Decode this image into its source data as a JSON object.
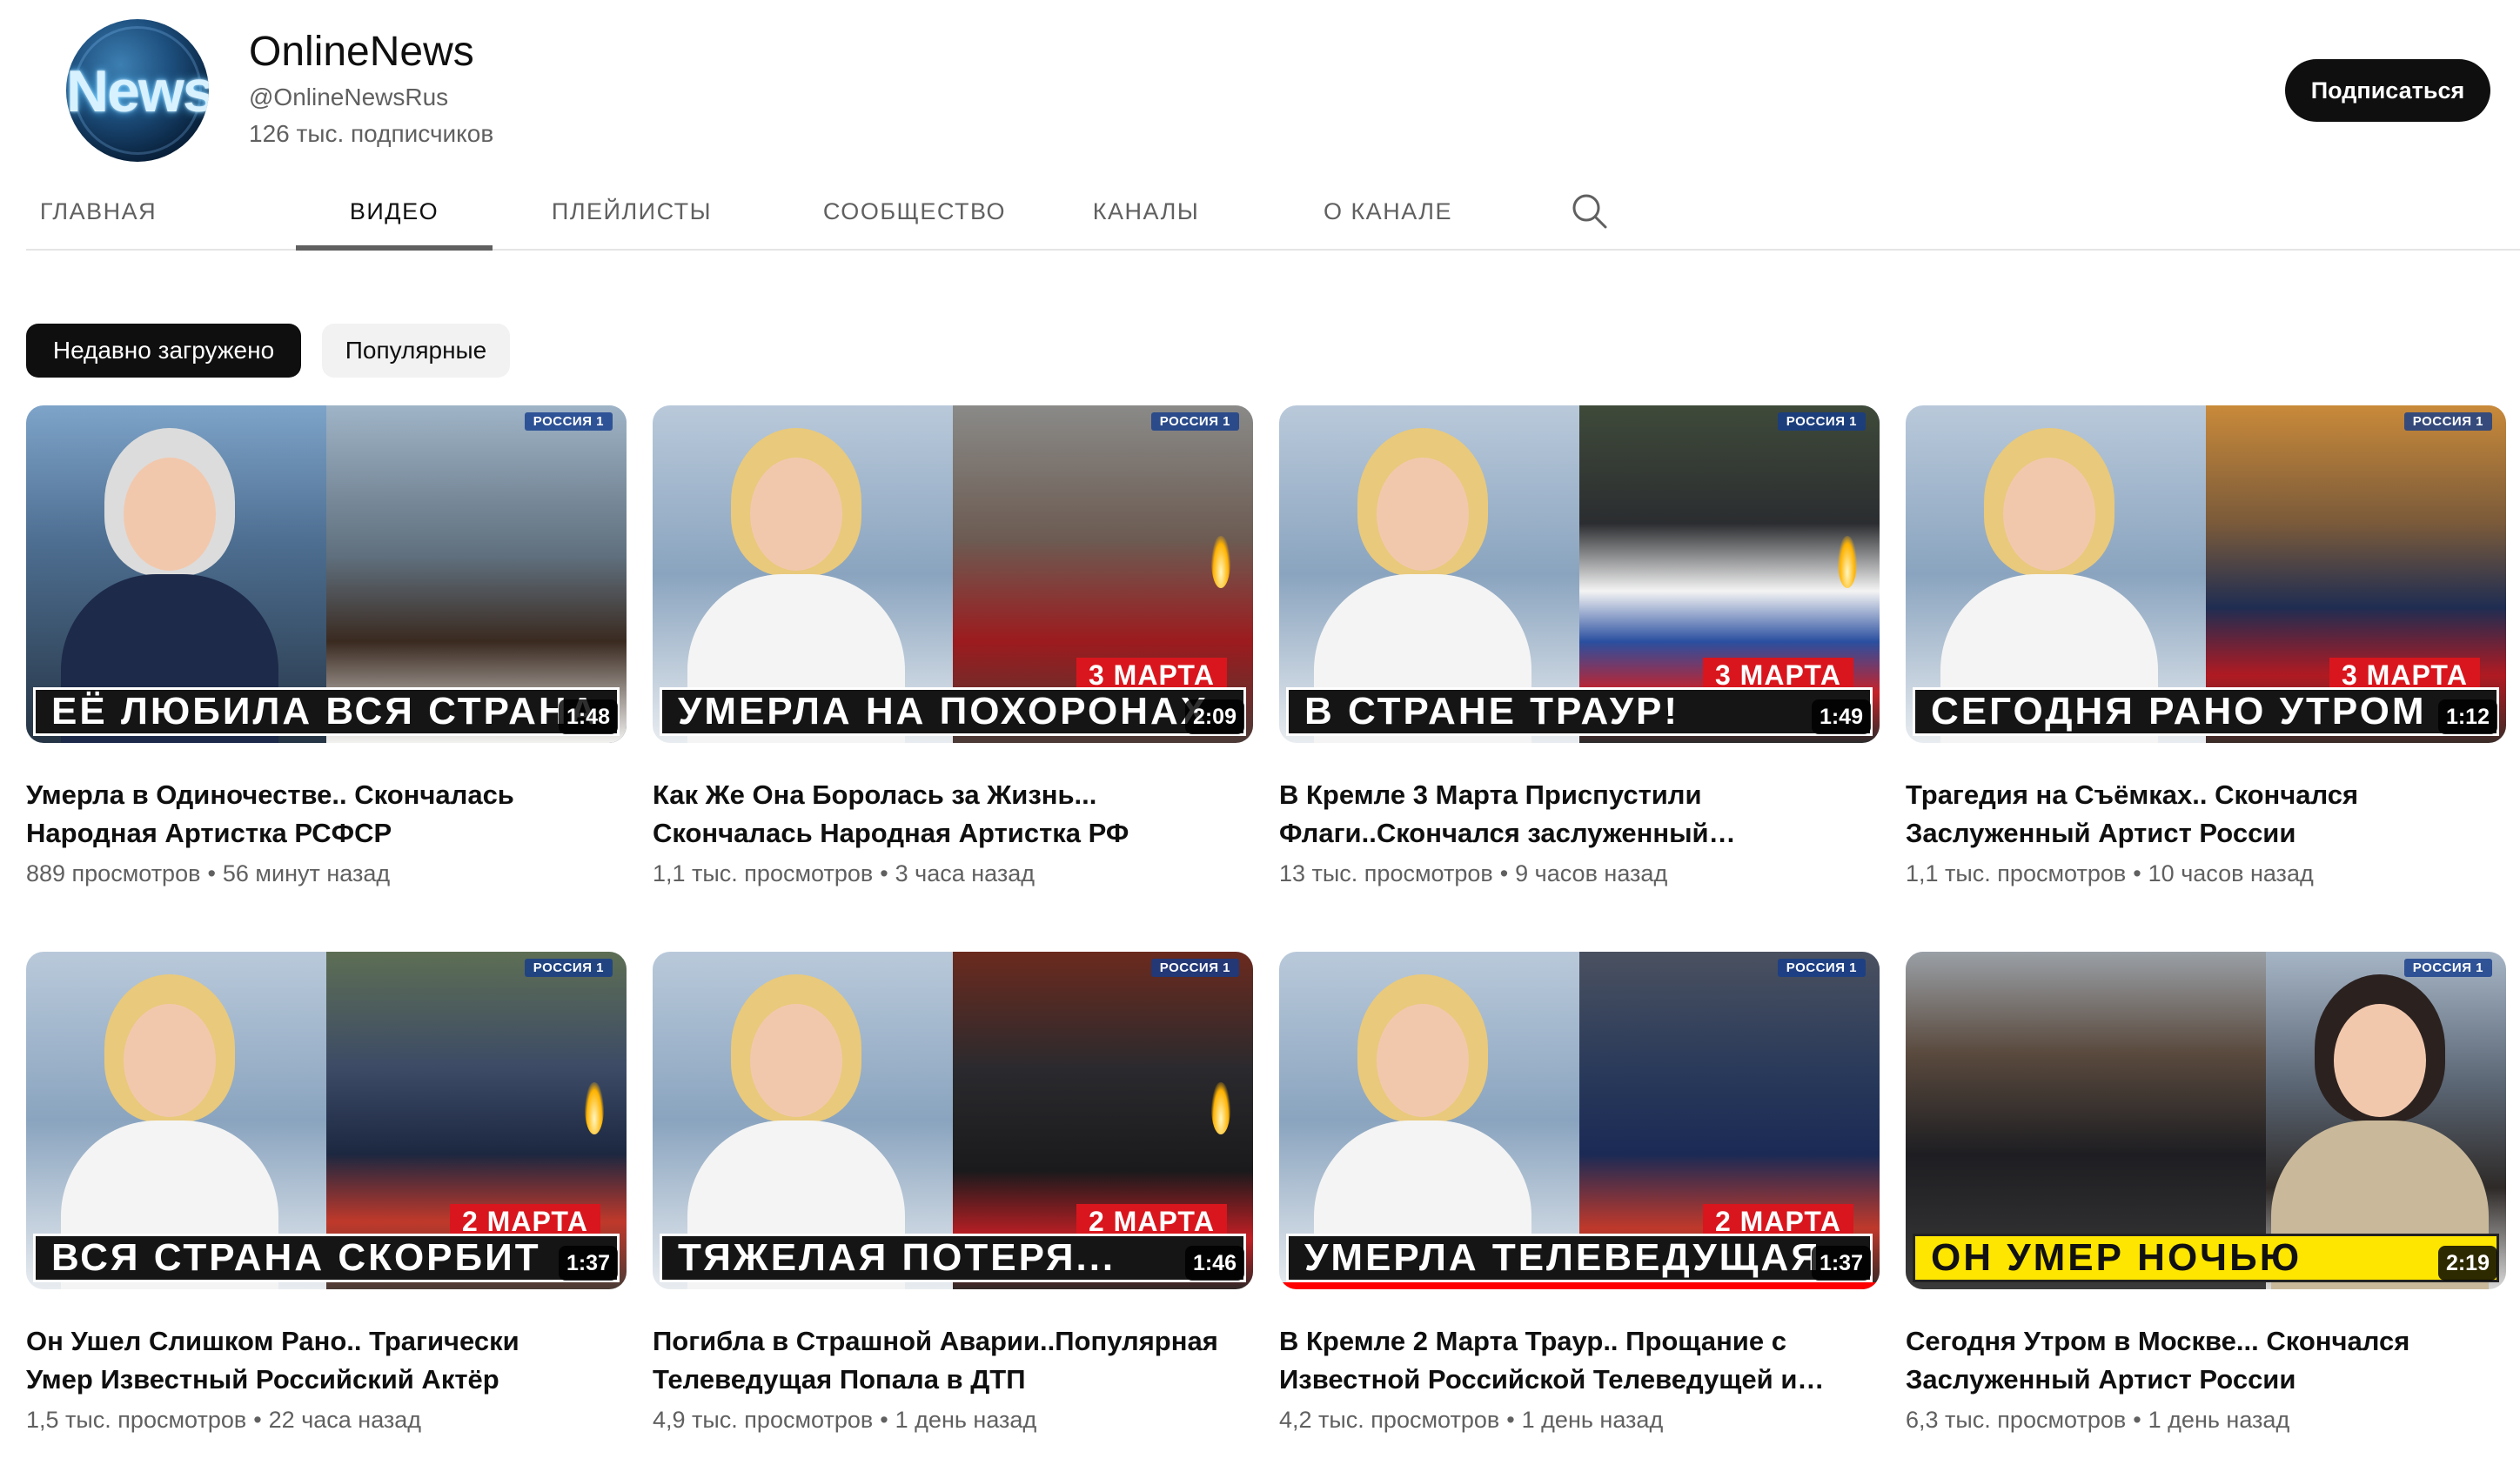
{
  "channel": {
    "avatar_text": "News",
    "name": "OnlineNews",
    "handle": "@OnlineNewsRus",
    "subscribers": "126 тыс. подписчиков",
    "subscribe_label": "Подписаться"
  },
  "tabs": [
    {
      "label": "ГЛАВНАЯ",
      "active": false
    },
    {
      "label": "ВИДЕО",
      "active": true
    },
    {
      "label": "ПЛЕЙЛИСТЫ",
      "active": false
    },
    {
      "label": "СООБЩЕСТВО",
      "active": false
    },
    {
      "label": "КАНАЛЫ",
      "active": false
    },
    {
      "label": "О КАНАЛЕ",
      "active": false
    }
  ],
  "search_icon": "search-icon",
  "chips": [
    {
      "label": "Недавно загружено",
      "selected": true
    },
    {
      "label": "Популярные",
      "selected": false
    }
  ],
  "videos": [
    {
      "caption": "ЕЁ ЛЮБИЛА ВСЯ СТРАНА",
      "date_tag": "",
      "channel_logo": "РОССИЯ 1",
      "duration": "1:48",
      "title_line1": "Умерла в Одиночестве.. Скончалась",
      "title_line2": "Народная Артистка РСФСР",
      "views": "889 просмотров",
      "age": "56 минут назад",
      "watched": false
    },
    {
      "caption": "УМЕРЛА НА ПОХОРОНАХ",
      "date_tag": "3 МАРТА",
      "channel_logo": "РОССИЯ 1",
      "duration": "2:09",
      "title_line1": "Как Же Она Боролась за Жизнь...",
      "title_line2": "Скончалась Народная Артистка РФ",
      "views": "1,1 тыс. просмотров",
      "age": "3 часа назад",
      "watched": false
    },
    {
      "caption": "В СТРАНЕ ТРАУР!",
      "date_tag": "3 МАРТА",
      "channel_logo": "РОССИЯ 1",
      "duration": "1:49",
      "title_line1": "В Кремле 3 Марта Приспустили",
      "title_line2": "Флаги..Скончался заслуженный…",
      "views": "13 тыс. просмотров",
      "age": "9 часов назад",
      "watched": false
    },
    {
      "caption": "СЕГОДНЯ РАНО УТРОМ",
      "date_tag": "3 МАРТА",
      "channel_logo": "РОССИЯ 1",
      "duration": "1:12",
      "title_line1": "Трагедия на Съёмках.. Скончался",
      "title_line2": "Заслуженный Артист России",
      "views": "1,1 тыс. просмотров",
      "age": "10 часов назад",
      "watched": false
    },
    {
      "caption": "ВСЯ СТРАНА СКОРБИТ",
      "date_tag": "2 МАРТА",
      "channel_logo": "РОССИЯ 1",
      "duration": "1:37",
      "title_line1": "Он Ушел Слишком Рано.. Трагически",
      "title_line2": "Умер Известный Российский Актёр",
      "views": "1,5 тыс. просмотров",
      "age": "22 часа назад",
      "watched": false
    },
    {
      "caption": "ТЯЖЕЛАЯ ПОТЕРЯ...",
      "date_tag": "2 МАРТА",
      "channel_logo": "РОССИЯ 1",
      "duration": "1:46",
      "title_line1": "Погибла в Страшной Аварии..Популярная",
      "title_line2": "Телеведущая Попала в ДТП",
      "views": "4,9 тыс. просмотров",
      "age": "1 день назад",
      "watched": false
    },
    {
      "caption": "УМЕРЛА ТЕЛЕВЕДУЩАЯ",
      "date_tag": "2 МАРТА",
      "channel_logo": "РОССИЯ 1",
      "duration": "1:37",
      "title_line1": "В Кремле 2 Марта Траур.. Прощание с",
      "title_line2": "Известной Российской Телеведущей и…",
      "views": "4,2 тыс. просмотров",
      "age": "1 день назад",
      "watched": true
    },
    {
      "caption": "ОН УМЕР НОЧЬЮ",
      "date_tag": "",
      "channel_logo": "РОССИЯ 1",
      "duration": "2:19",
      "title_line1": "Сегодня Утром в Москве... Скончался",
      "title_line2": "Заслуженный Артист России",
      "views": "6,3 тыс. просмотров",
      "age": "1 день назад",
      "watched": false
    }
  ],
  "colors": {
    "accent_dark": "#0f0f0f",
    "secondary_text": "#606060",
    "chip_bg": "#f2f2f2",
    "date_tag_red": "#d9161d",
    "progress_red": "#ff0000",
    "caption_yellow": "#ffe600"
  }
}
